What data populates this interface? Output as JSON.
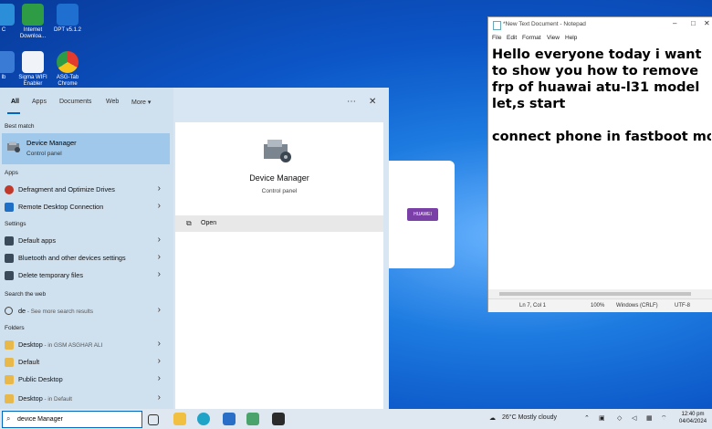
{
  "desktop_icons": [
    {
      "label": "C",
      "color": "#2a8fd8"
    },
    {
      "label": "Internet Downloa...",
      "color": "#2e9b45"
    },
    {
      "label": "DPT v5.1.2",
      "color": "#1e6fd0"
    },
    {
      "label": "lb",
      "color": "#3a7bd5"
    },
    {
      "label": "Sigma WIFI Enabler",
      "color": "#f0f4f8"
    },
    {
      "label": "ASG-Tab Chrome",
      "color": "#e33b2e"
    }
  ],
  "start_menu": {
    "tabs": [
      "All",
      "Apps",
      "Documents",
      "Web",
      "More ▾"
    ],
    "more_icon": "⋯",
    "close_icon": "✕",
    "best_match_heading": "Best match",
    "best_match": {
      "title": "Device Manager",
      "subtitle": "Control panel"
    },
    "apps_heading": "Apps",
    "apps": [
      "Defragment and Optimize Drives",
      "Remote Desktop Connection"
    ],
    "settings_heading": "Settings",
    "settings": [
      "Default apps",
      "Bluetooth and other devices settings",
      "Delete temporary files"
    ],
    "web_heading": "Search the web",
    "web": {
      "query": "de",
      "suffix": " - See more search results"
    },
    "folders_heading": "Folders",
    "folders": [
      {
        "name": "Desktop",
        "location": " - in GSM ASGHAR ALI"
      },
      {
        "name": "Default",
        "location": ""
      },
      {
        "name": "Public Desktop",
        "location": ""
      },
      {
        "name": "Desktop",
        "location": " - in Default"
      }
    ],
    "preview": {
      "title": "Device Manager",
      "subtitle": "Control panel",
      "action": "Open"
    }
  },
  "background_window": {
    "badge": "HUAWEI",
    "badge_color": "#7b3fa8"
  },
  "notepad": {
    "title": "*New Text Document - Notepad",
    "menu": [
      "File",
      "Edit",
      "Format",
      "View",
      "Help"
    ],
    "content": "Hello everyone today i want\nto show you how to remove\nfrp of huawai atu-l31 model\nlet,s start\n\nconnect phone in fastboot mode",
    "status": {
      "position": "Ln 7, Col 1",
      "zoom": "100%",
      "line_ending": "Windows (CRLF)",
      "encoding": "UTF-8"
    }
  },
  "taskbar": {
    "search_value": "device Manager",
    "weather": "26°C  Mostly cloudy",
    "time": "12:40 pm",
    "date": "04/04/2024"
  },
  "colors": {
    "accent": "#0067c0",
    "selected": "#9fc8ea",
    "start_bg": "#cfe0ef"
  }
}
